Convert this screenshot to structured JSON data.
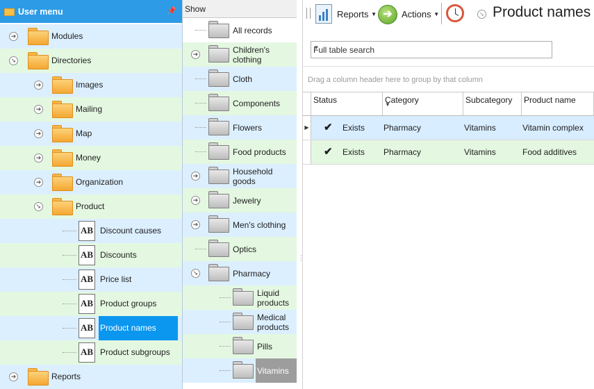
{
  "user_menu": {
    "title": "User menu",
    "pin_icon": "pin-icon",
    "items": [
      {
        "label": "Modules"
      },
      {
        "label": "Directories"
      },
      {
        "label": "Images"
      },
      {
        "label": "Mailing"
      },
      {
        "label": "Map"
      },
      {
        "label": "Money"
      },
      {
        "label": "Organization"
      },
      {
        "label": "Product"
      },
      {
        "label": "Discount causes"
      },
      {
        "label": "Discounts"
      },
      {
        "label": "Price list"
      },
      {
        "label": "Product groups"
      },
      {
        "label": "Product names"
      },
      {
        "label": "Product subgroups"
      },
      {
        "label": "Reports"
      }
    ]
  },
  "show_panel": {
    "header": "Show",
    "items": [
      {
        "label": "All records"
      },
      {
        "label": "Children's clothing"
      },
      {
        "label": "Cloth"
      },
      {
        "label": "Components"
      },
      {
        "label": "Flowers"
      },
      {
        "label": "Food products"
      },
      {
        "label": "Household goods"
      },
      {
        "label": "Jewelry"
      },
      {
        "label": "Men's clothing"
      },
      {
        "label": "Optics"
      },
      {
        "label": "Pharmacy"
      },
      {
        "label": "Liquid products"
      },
      {
        "label": "Medical products"
      },
      {
        "label": "Pills"
      },
      {
        "label": "Vitamins"
      }
    ]
  },
  "toolbar": {
    "reports_label": "Reports",
    "actions_label": "Actions",
    "page_title": "Product names"
  },
  "search": {
    "value": "Full table search"
  },
  "group_bar": {
    "hint": "Drag a column header here to group by that column"
  },
  "grid": {
    "columns": [
      "Status",
      "Category",
      "Subcategory",
      "Product name"
    ],
    "rows": [
      {
        "status": "Exists",
        "category": "Pharmacy",
        "subcategory": "Vitamins",
        "product_name": "Vitamin complex"
      },
      {
        "status": "Exists",
        "category": "Pharmacy",
        "subcategory": "Vitamins",
        "product_name": "Food additives"
      }
    ]
  },
  "colors": {
    "header_blue": "#2d9be6",
    "row_blue": "#dcefff",
    "row_green": "#e4f8e1",
    "selected_blue": "#0b97f0",
    "selected_gray": "#9d9d9d"
  },
  "icons": {
    "folder": "folder-icon",
    "text_document": "ab-document-icon",
    "expand": "expand-arrow-icon",
    "collapse": "collapse-arrow-icon",
    "reports": "reports-icon",
    "actions": "actions-arrow-icon",
    "clock": "clock-icon",
    "check": "checkmark-icon"
  }
}
